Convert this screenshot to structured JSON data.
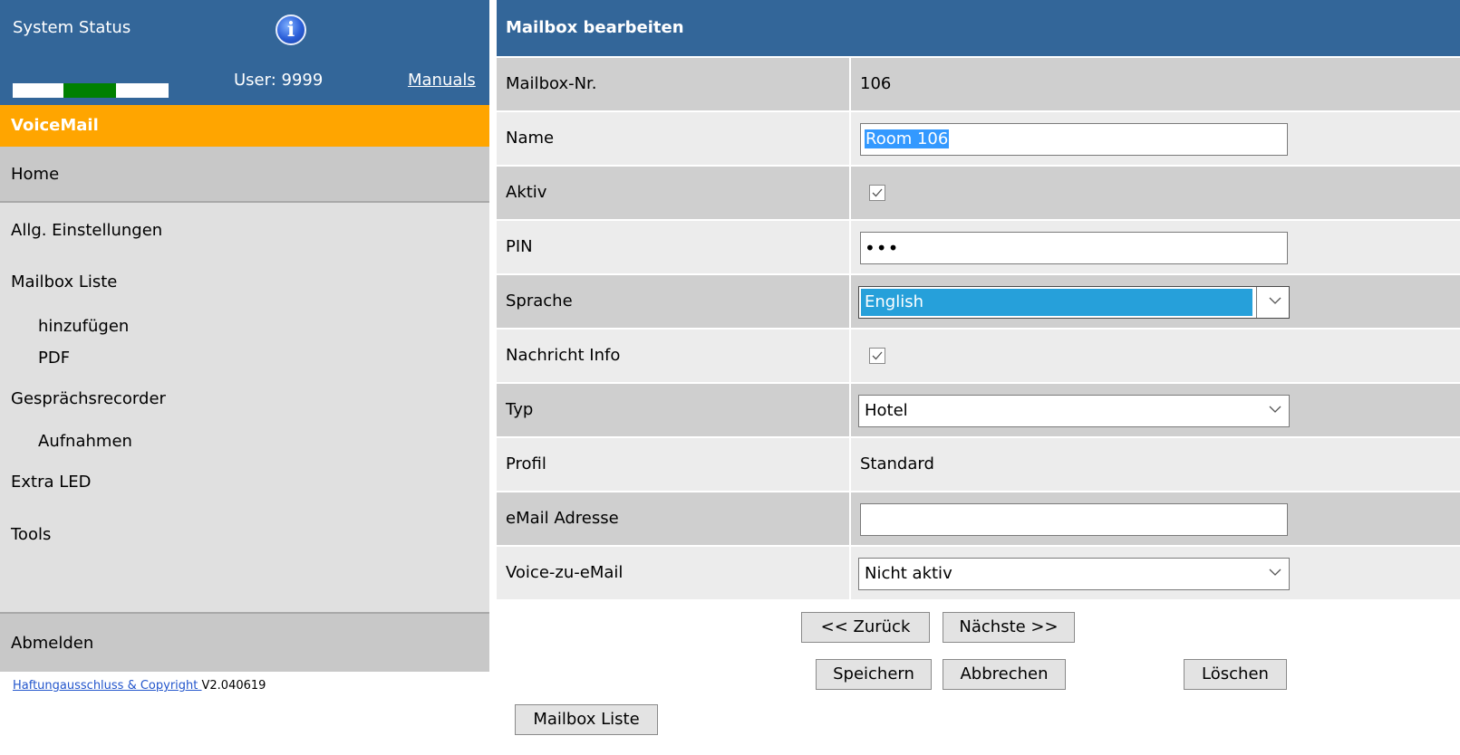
{
  "sidebar": {
    "title": "System Status",
    "user_label": "User: 9999",
    "manuals": "Manuals",
    "section": "VoiceMail",
    "status_colors": [
      "#ffffff",
      "#008000",
      "#ffffff"
    ],
    "home": "Home",
    "items": [
      {
        "label": "Allg. Einstellungen"
      },
      {
        "label": "Mailbox Liste"
      },
      {
        "label": "hinzufügen"
      },
      {
        "label": "PDF"
      },
      {
        "label": "Gesprächsrecorder"
      },
      {
        "label": "Aufnahmen"
      },
      {
        "label": "Extra LED"
      },
      {
        "label": "Tools"
      }
    ],
    "logout": "Abmelden",
    "footer_link": "Haftungausschluss & Copyright ",
    "version": "V2.040619"
  },
  "form": {
    "title": "Mailbox bearbeiten",
    "fields": {
      "mailbox_nr": {
        "label": "Mailbox-Nr.",
        "value": "106"
      },
      "name": {
        "label": "Name",
        "value": "Room 106"
      },
      "aktiv": {
        "label": "Aktiv",
        "checked": true
      },
      "pin": {
        "label": "PIN",
        "value": "•••"
      },
      "sprache": {
        "label": "Sprache",
        "value": "English"
      },
      "nachricht_info": {
        "label": "Nachricht Info",
        "checked": true
      },
      "typ": {
        "label": "Typ",
        "value": "Hotel"
      },
      "profil": {
        "label": "Profil",
        "value": "Standard"
      },
      "email": {
        "label": "eMail Adresse",
        "value": ""
      },
      "voice_email": {
        "label": "Voice-zu-eMail",
        "value": "Nicht aktiv"
      }
    }
  },
  "buttons": {
    "back": "<< Zurück",
    "next": "Nächste >>",
    "save": "Speichern",
    "cancel": "Abbrechen",
    "delete": "Löschen",
    "mailbox_list": "Mailbox Liste"
  },
  "colors": {
    "header_blue": "#336699",
    "accent_orange": "#ffa500",
    "selection_blue": "#26a0da"
  }
}
